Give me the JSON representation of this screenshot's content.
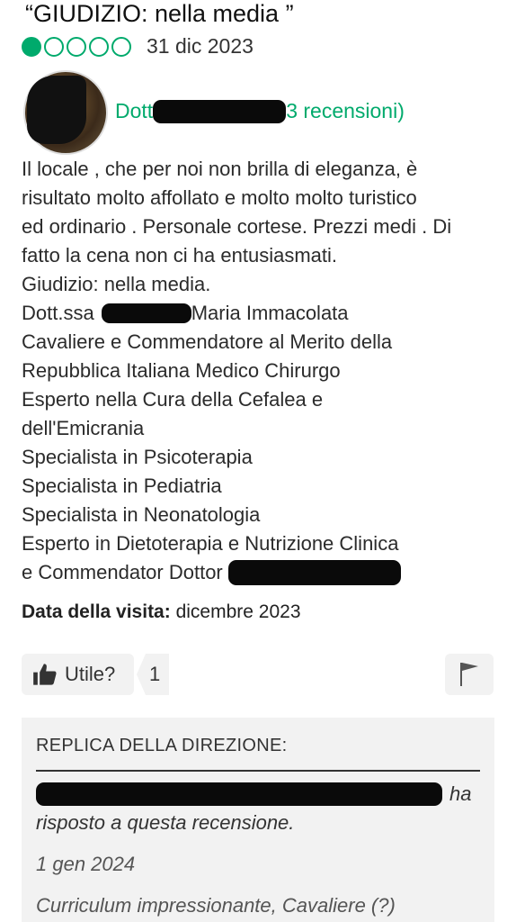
{
  "review": {
    "title": "“GIUDIZIO: nella media ”",
    "rating": 1,
    "rating_max": 5,
    "accent_color": "#00aa6c",
    "date": "31 dic 2023",
    "author_prefix": "Dott",
    "author_suffix": "3 recensioni)",
    "body_lines": [
      "Il locale  , che per noi non brilla di eleganza, è",
      "risultato molto affollato e molto molto turistico",
      "ed ordinario . Personale cortese. Prezzi medi . Di",
      "fatto la cena non ci ha entusiasmati.",
      "Giudizio: nella media.",
      "Dott.ssa",
      "Maria Immacolata",
      "Cavaliere e Commendatore al Merito della",
      "Repubblica Italiana Medico Chirurgo",
      "Esperto nella Cura della Cefalea e",
      "dell'Emicrania",
      "Specialista in Psicoterapia",
      "Specialista in Pediatria",
      "Specialista in Neonatologia",
      "Esperto in Dietoterapia e Nutrizione Clinica",
      "e Commendator Dottor"
    ],
    "visit_label": "Data della visita:",
    "visit_value": "dicembre 2023",
    "useful_label": "Utile?",
    "useful_count": "1"
  },
  "reply": {
    "header": "REPLICA DELLA DIREZIONE:",
    "line1_suffix": "ha",
    "line2": "risposto a questa recensione.",
    "date": "1 gen 2024",
    "text": "Curriculum impressionante, Cavaliere (?)"
  }
}
